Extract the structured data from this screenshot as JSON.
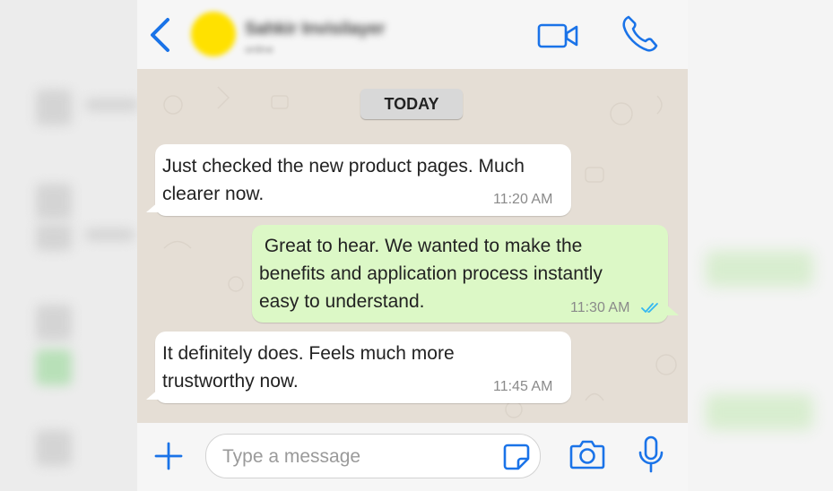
{
  "colors": {
    "accent": "#1a73e8",
    "incoming_bubble": "#ffffff",
    "outgoing_bubble": "#dcf8c6",
    "chat_background": "#e5ded5",
    "read_ticks": "#34b7f1"
  },
  "header": {
    "contact_name": "Sahkir Invisilayer",
    "contact_status": "online",
    "icons": [
      "back-icon",
      "video-call-icon",
      "phone-call-icon"
    ]
  },
  "chat": {
    "date_label": "TODAY",
    "messages": [
      {
        "direction": "incoming",
        "lines": [
          "Just checked the new product pages. Much",
          "clearer now."
        ],
        "time": "11:20 AM"
      },
      {
        "direction": "outgoing",
        "lines": [
          " Great to hear. We wanted to make the",
          "benefits and application process instantly",
          "easy to understand."
        ],
        "time": "11:30 AM",
        "status": "read"
      },
      {
        "direction": "incoming",
        "lines": [
          "It definitely does. Feels much more",
          "trustworthy now."
        ],
        "time": "11:45 AM"
      }
    ]
  },
  "composer": {
    "placeholder": "Type a message",
    "value": "",
    "icons": [
      "plus-icon",
      "sticker-icon",
      "camera-icon",
      "microphone-icon"
    ]
  }
}
